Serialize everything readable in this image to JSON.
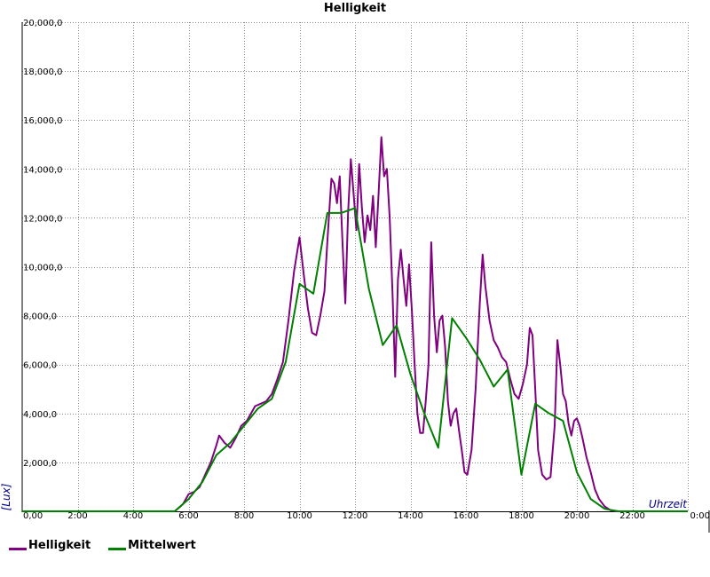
{
  "chart_data": {
    "type": "line",
    "title": "Helligkeit",
    "xlabel": "Uhrzeit",
    "ylabel": "[Lux]",
    "xlim": [
      0,
      24
    ],
    "ylim": [
      0,
      20000
    ],
    "x_ticks": [
      "0,00",
      "2:00",
      "4:00",
      "6:00",
      "8:00",
      "10:00",
      "12:00",
      "14:00",
      "16:00",
      "18:00",
      "20:00",
      "22:00",
      "0:00"
    ],
    "y_ticks": [
      "2,000,0",
      "4,000,0",
      "6,000,0",
      "8,000,0",
      "10,000,0",
      "12,000,0",
      "14,000,0",
      "16,000,0",
      "18,000,0",
      "20,000,0"
    ],
    "grid": true,
    "legend_position": "bottom-left",
    "series": [
      {
        "name": "Helligkeit",
        "color": "#800080",
        "points": [
          [
            0,
            0
          ],
          [
            5.5,
            0
          ],
          [
            5.8,
            300
          ],
          [
            6.0,
            700
          ],
          [
            6.2,
            800
          ],
          [
            6.4,
            1000
          ],
          [
            6.6,
            1500
          ],
          [
            6.8,
            2000
          ],
          [
            7.0,
            2700
          ],
          [
            7.1,
            3100
          ],
          [
            7.3,
            2800
          ],
          [
            7.5,
            2600
          ],
          [
            7.7,
            3000
          ],
          [
            7.9,
            3500
          ],
          [
            8.1,
            3700
          ],
          [
            8.3,
            4100
          ],
          [
            8.4,
            4300
          ],
          [
            8.6,
            4400
          ],
          [
            8.8,
            4500
          ],
          [
            9.0,
            4800
          ],
          [
            9.2,
            5400
          ],
          [
            9.4,
            6100
          ],
          [
            9.6,
            7800
          ],
          [
            9.8,
            9800
          ],
          [
            10.0,
            11200
          ],
          [
            10.15,
            9700
          ],
          [
            10.3,
            8300
          ],
          [
            10.45,
            7300
          ],
          [
            10.6,
            7200
          ],
          [
            10.75,
            8000
          ],
          [
            10.9,
            9000
          ],
          [
            11.0,
            11000
          ],
          [
            11.15,
            13600
          ],
          [
            11.25,
            13400
          ],
          [
            11.35,
            12600
          ],
          [
            11.45,
            13700
          ],
          [
            11.55,
            11000
          ],
          [
            11.65,
            8500
          ],
          [
            11.75,
            12200
          ],
          [
            11.85,
            14400
          ],
          [
            11.95,
            13000
          ],
          [
            12.05,
            11500
          ],
          [
            12.15,
            14200
          ],
          [
            12.25,
            12400
          ],
          [
            12.35,
            11000
          ],
          [
            12.45,
            12100
          ],
          [
            12.55,
            11500
          ],
          [
            12.65,
            12900
          ],
          [
            12.75,
            10800
          ],
          [
            12.85,
            13000
          ],
          [
            12.95,
            15300
          ],
          [
            13.05,
            13700
          ],
          [
            13.15,
            14000
          ],
          [
            13.25,
            12000
          ],
          [
            13.35,
            9000
          ],
          [
            13.45,
            5500
          ],
          [
            13.55,
            9500
          ],
          [
            13.65,
            10700
          ],
          [
            13.75,
            9500
          ],
          [
            13.85,
            8400
          ],
          [
            13.95,
            10100
          ],
          [
            14.05,
            8200
          ],
          [
            14.15,
            6000
          ],
          [
            14.25,
            4000
          ],
          [
            14.35,
            3200
          ],
          [
            14.45,
            3200
          ],
          [
            14.55,
            4500
          ],
          [
            14.65,
            6000
          ],
          [
            14.75,
            11000
          ],
          [
            14.85,
            8000
          ],
          [
            14.95,
            6500
          ],
          [
            15.05,
            7800
          ],
          [
            15.15,
            8000
          ],
          [
            15.25,
            6700
          ],
          [
            15.35,
            4500
          ],
          [
            15.45,
            3500
          ],
          [
            15.55,
            4000
          ],
          [
            15.65,
            4200
          ],
          [
            15.75,
            3300
          ],
          [
            15.85,
            2500
          ],
          [
            15.95,
            1600
          ],
          [
            16.05,
            1500
          ],
          [
            16.2,
            2500
          ],
          [
            16.35,
            5000
          ],
          [
            16.5,
            8500
          ],
          [
            16.6,
            10500
          ],
          [
            16.7,
            9200
          ],
          [
            16.85,
            7800
          ],
          [
            17.0,
            7000
          ],
          [
            17.15,
            6700
          ],
          [
            17.3,
            6300
          ],
          [
            17.45,
            6100
          ],
          [
            17.6,
            5400
          ],
          [
            17.75,
            4800
          ],
          [
            17.9,
            4600
          ],
          [
            18.05,
            5200
          ],
          [
            18.2,
            6000
          ],
          [
            18.3,
            7500
          ],
          [
            18.4,
            7200
          ],
          [
            18.5,
            5000
          ],
          [
            18.6,
            2500
          ],
          [
            18.75,
            1500
          ],
          [
            18.9,
            1300
          ],
          [
            19.05,
            1400
          ],
          [
            19.2,
            3500
          ],
          [
            19.3,
            7000
          ],
          [
            19.4,
            6000
          ],
          [
            19.5,
            4800
          ],
          [
            19.6,
            4500
          ],
          [
            19.7,
            3600
          ],
          [
            19.8,
            3100
          ],
          [
            19.9,
            3700
          ],
          [
            20.0,
            3800
          ],
          [
            20.1,
            3500
          ],
          [
            20.2,
            3000
          ],
          [
            20.35,
            2200
          ],
          [
            20.5,
            1600
          ],
          [
            20.65,
            900
          ],
          [
            20.8,
            500
          ],
          [
            21.0,
            200
          ],
          [
            21.2,
            50
          ],
          [
            21.4,
            0
          ],
          [
            24,
            0
          ]
        ]
      },
      {
        "name": "Mittelwert",
        "color": "#008000",
        "points": [
          [
            0,
            0
          ],
          [
            5.5,
            0
          ],
          [
            6.0,
            500
          ],
          [
            6.5,
            1200
          ],
          [
            7.0,
            2300
          ],
          [
            7.5,
            2800
          ],
          [
            8.0,
            3500
          ],
          [
            8.5,
            4200
          ],
          [
            9.0,
            4600
          ],
          [
            9.5,
            6100
          ],
          [
            10.0,
            9300
          ],
          [
            10.5,
            8900
          ],
          [
            11.0,
            12200
          ],
          [
            11.5,
            12200
          ],
          [
            12.0,
            12400
          ],
          [
            12.5,
            9100
          ],
          [
            13.0,
            6800
          ],
          [
            13.5,
            7600
          ],
          [
            14.0,
            5600
          ],
          [
            14.5,
            4000
          ],
          [
            15.0,
            2600
          ],
          [
            15.5,
            7900
          ],
          [
            16.0,
            7100
          ],
          [
            16.5,
            6200
          ],
          [
            17.0,
            5100
          ],
          [
            17.5,
            5800
          ],
          [
            18.0,
            1500
          ],
          [
            18.5,
            4400
          ],
          [
            19.0,
            4000
          ],
          [
            19.5,
            3700
          ],
          [
            20.0,
            1600
          ],
          [
            20.5,
            500
          ],
          [
            21.0,
            100
          ],
          [
            21.5,
            0
          ],
          [
            24,
            0
          ]
        ]
      }
    ]
  }
}
